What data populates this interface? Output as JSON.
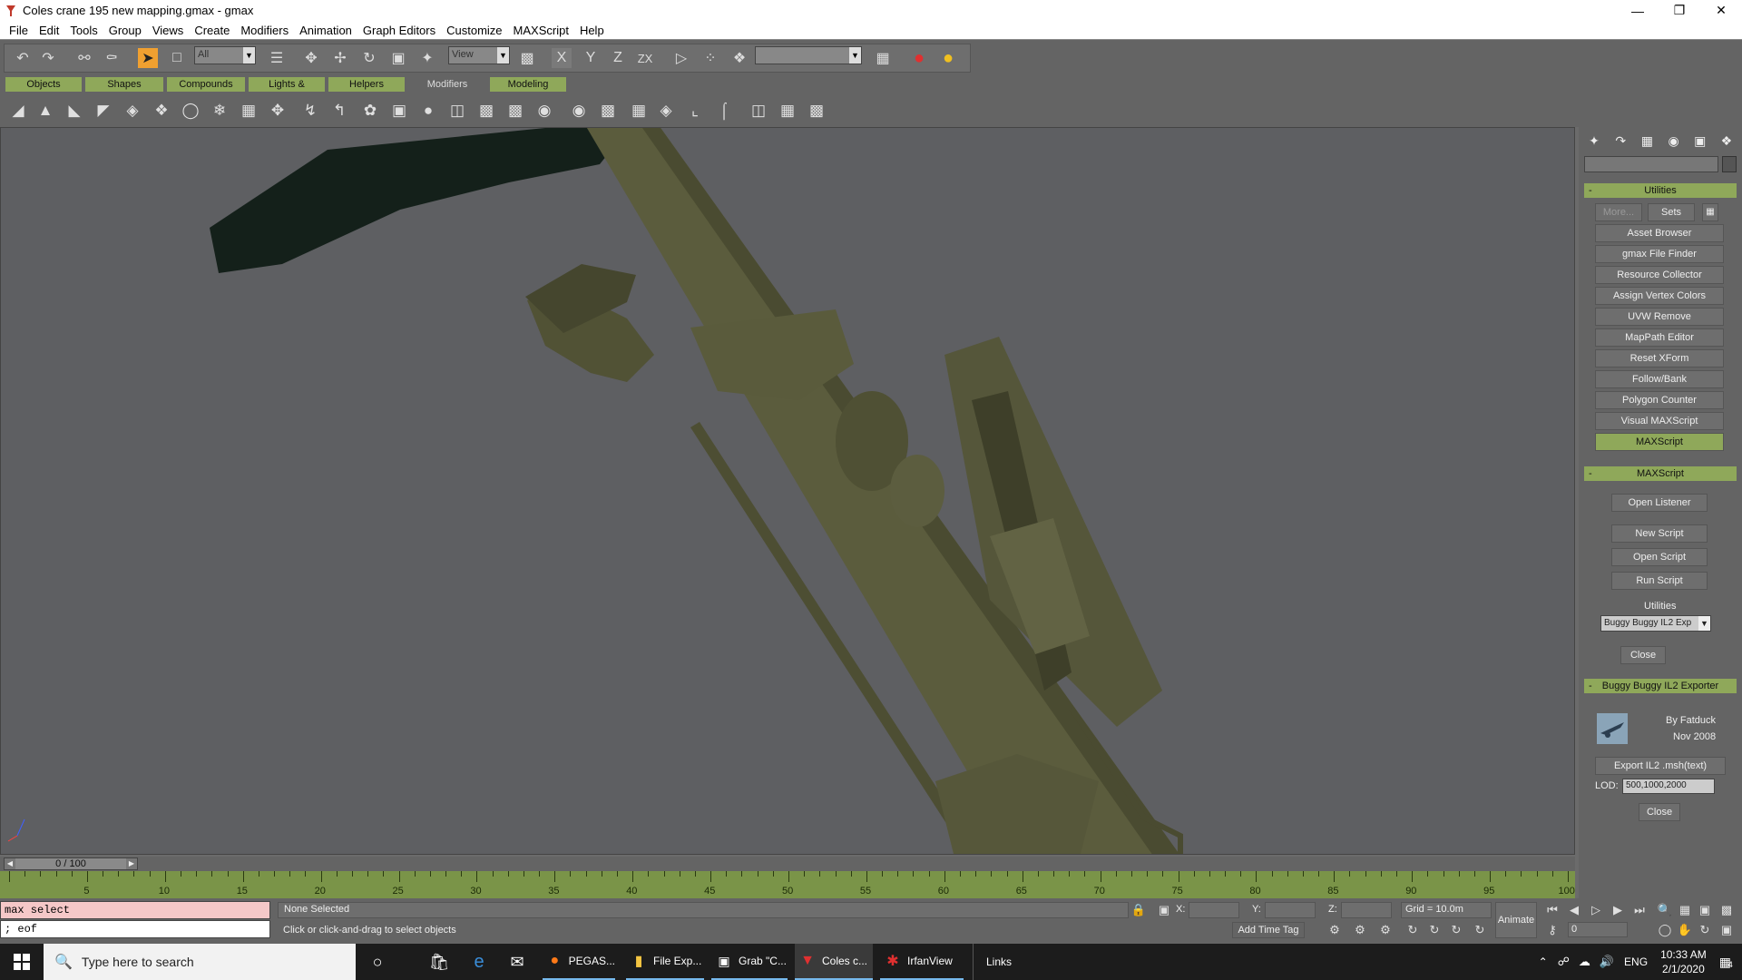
{
  "window": {
    "title": "Coles crane 195 new mapping.gmax - gmax"
  },
  "menu": [
    "File",
    "Edit",
    "Tools",
    "Group",
    "Views",
    "Create",
    "Modifiers",
    "Animation",
    "Graph Editors",
    "Customize",
    "MAXScript",
    "Help"
  ],
  "toolbar": {
    "selection_filter": "All",
    "ref_coord": "View",
    "named_selection": ""
  },
  "tabs": [
    "Objects",
    "Shapes",
    "Compounds",
    "Lights & Cameras",
    "Helpers",
    "Modifiers",
    "Modeling"
  ],
  "active_tab": "Modifiers",
  "command_panel": {
    "utilities_title": "Utilities",
    "more_label": "More...",
    "sets_label": "Sets",
    "utility_buttons": [
      "Asset Browser",
      "gmax File Finder",
      "Resource Collector",
      "Assign Vertex Colors",
      "UVW Remove",
      "MapPath Editor",
      "Reset XForm",
      "Follow/Bank",
      "Polygon Counter",
      "Visual MAXScript",
      "MAXScript"
    ],
    "active_utility": "MAXScript",
    "maxscript_title": "MAXScript",
    "maxscript_buttons": [
      "Open Listener",
      "New Script",
      "Open Script",
      "Run Script"
    ],
    "utilities_label": "Utilities",
    "utilities_dropdown": "Buggy Buggy IL2 Exp",
    "close_label": "Close",
    "exporter_title": "Buggy Buggy IL2 Exporter",
    "exporter_author": "By Fatduck",
    "exporter_date": "Nov 2008",
    "export_button": "Export IL2 .msh(text)",
    "lod_label": "LOD:",
    "lod_value": "500,1000,2000",
    "exporter_close": "Close"
  },
  "timeline": {
    "slider_label": "0 / 100",
    "ticks": [
      "5",
      "10",
      "15",
      "20",
      "25",
      "30",
      "35",
      "40",
      "45",
      "50",
      "55",
      "60",
      "65",
      "70",
      "75",
      "80",
      "85",
      "90",
      "95",
      "100"
    ]
  },
  "status": {
    "listener_input": "max select",
    "listener_output": "; eof",
    "selection": "None Selected",
    "prompt": "Click or click-and-drag to select objects",
    "x_label": "X:",
    "y_label": "Y:",
    "z_label": "Z:",
    "grid": "Grid = 10.0m",
    "add_time_tag": "Add Time Tag",
    "animate": "Animate",
    "frame": "0"
  },
  "taskbar": {
    "search_placeholder": "Type here to search",
    "apps": [
      {
        "label": "PEGAS..."
      },
      {
        "label": "File Exp..."
      },
      {
        "label": "Grab \"C..."
      },
      {
        "label": "Coles c..."
      },
      {
        "label": "IrfanView"
      }
    ],
    "links": "Links",
    "language": "ENG",
    "time": "10:33 AM",
    "date": "2/1/2020",
    "notification_count": "4"
  },
  "colors": {
    "accent_green": "#8fa85a",
    "ui_gray": "#646464",
    "viewport_bg": "#5e5f62",
    "model_olive": "#5f6042"
  }
}
